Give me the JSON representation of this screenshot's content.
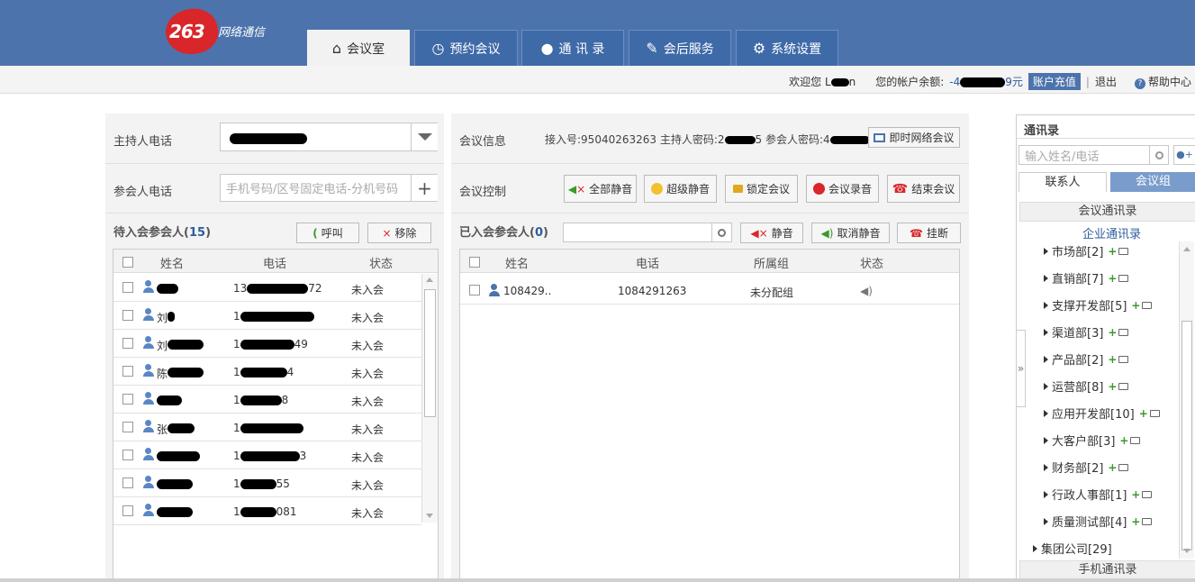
{
  "header": {
    "logo_number": "263",
    "logo_text": "网络通信",
    "tabs": [
      {
        "label": "会议室",
        "icon": "home-icon",
        "active": true
      },
      {
        "label": "预约会议",
        "icon": "clock-icon",
        "active": false
      },
      {
        "label": "通 讯 录",
        "icon": "user-icon",
        "active": false
      },
      {
        "label": "会后服务",
        "icon": "edit-icon",
        "active": false
      },
      {
        "label": "系统设置",
        "icon": "gear-icon",
        "active": false
      }
    ]
  },
  "subbar": {
    "welcome": "欢迎您 L",
    "welcome_tail": "n",
    "balance_label": "您的帐户余额:",
    "balance_value": "-4",
    "balance_tail": "9元",
    "recharge": "账户充值",
    "separator": "|",
    "logout": "退出",
    "help": "帮助中心"
  },
  "left_panel": {
    "host_label": "主持人电话",
    "host_value": "",
    "participant_label": "参会人电话",
    "participant_placeholder": "手机号码/区号固定电话-分机号码",
    "pending_title": "待入会参会人",
    "pending_count": "15",
    "call_button": "呼叫",
    "remove_button": "移除",
    "columns": [
      "姓名",
      "电话",
      "状态"
    ],
    "rows": [
      {
        "name": "",
        "phone": "13",
        "phone_tail": "72",
        "status": "未入会"
      },
      {
        "name": "刘",
        "phone": "1",
        "phone_tail": "",
        "status": "未入会"
      },
      {
        "name": "刘",
        "phone": "1",
        "phone_tail": "49",
        "status": "未入会"
      },
      {
        "name": "陈",
        "phone": "1",
        "phone_tail": "4",
        "status": "未入会"
      },
      {
        "name": "",
        "phone": "1",
        "phone_tail": "8",
        "status": "未入会"
      },
      {
        "name": "张",
        "phone": "1",
        "phone_tail": "",
        "status": "未入会"
      },
      {
        "name": "",
        "phone": "1",
        "phone_tail": "3",
        "status": "未入会"
      },
      {
        "name": "",
        "phone": "1",
        "phone_tail": "55",
        "status": "未入会"
      },
      {
        "name": "",
        "phone": "1",
        "phone_tail": "081",
        "status": "未入会"
      }
    ]
  },
  "middle_panel": {
    "info_label": "会议信息",
    "info_text": "接入号:95040263263 主持人密码:2",
    "info_text_mid": "5 参会人密码:4",
    "info_text_tail": "",
    "instant_meeting": "即时网络会议",
    "control_label": "会议控制",
    "controls": [
      "全部静音",
      "超级静音",
      "锁定会议",
      "会议录音",
      "结束会议"
    ],
    "joined_title": "已入会参会人",
    "joined_count": "0",
    "mute": "静音",
    "unmute": "取消静音",
    "hangup": "挂断",
    "columns": [
      "姓名",
      "电话",
      "所属组",
      "状态"
    ],
    "rows": [
      {
        "name": "108429..",
        "phone": "1084291263",
        "group": "未分配组"
      }
    ]
  },
  "contacts": {
    "title": "通讯录",
    "search_placeholder": "输入姓名/电话",
    "tabs": [
      "联系人",
      "会议组"
    ],
    "meeting_contacts": "会议通讯录",
    "enterprise_contacts": "企业通讯录",
    "expand_arrow": "»",
    "departments": [
      "市场部[2]",
      "直销部[7]",
      "支撑开发部[5]",
      "渠道部[3]",
      "产品部[2]",
      "运营部[8]",
      "应用开发部[10]",
      "大客户部[3]",
      "财务部[2]",
      "行政人事部[1]",
      "质量测试部[4]"
    ],
    "group_company": "集团公司[29]",
    "mobile_contacts": "手机通讯录"
  }
}
